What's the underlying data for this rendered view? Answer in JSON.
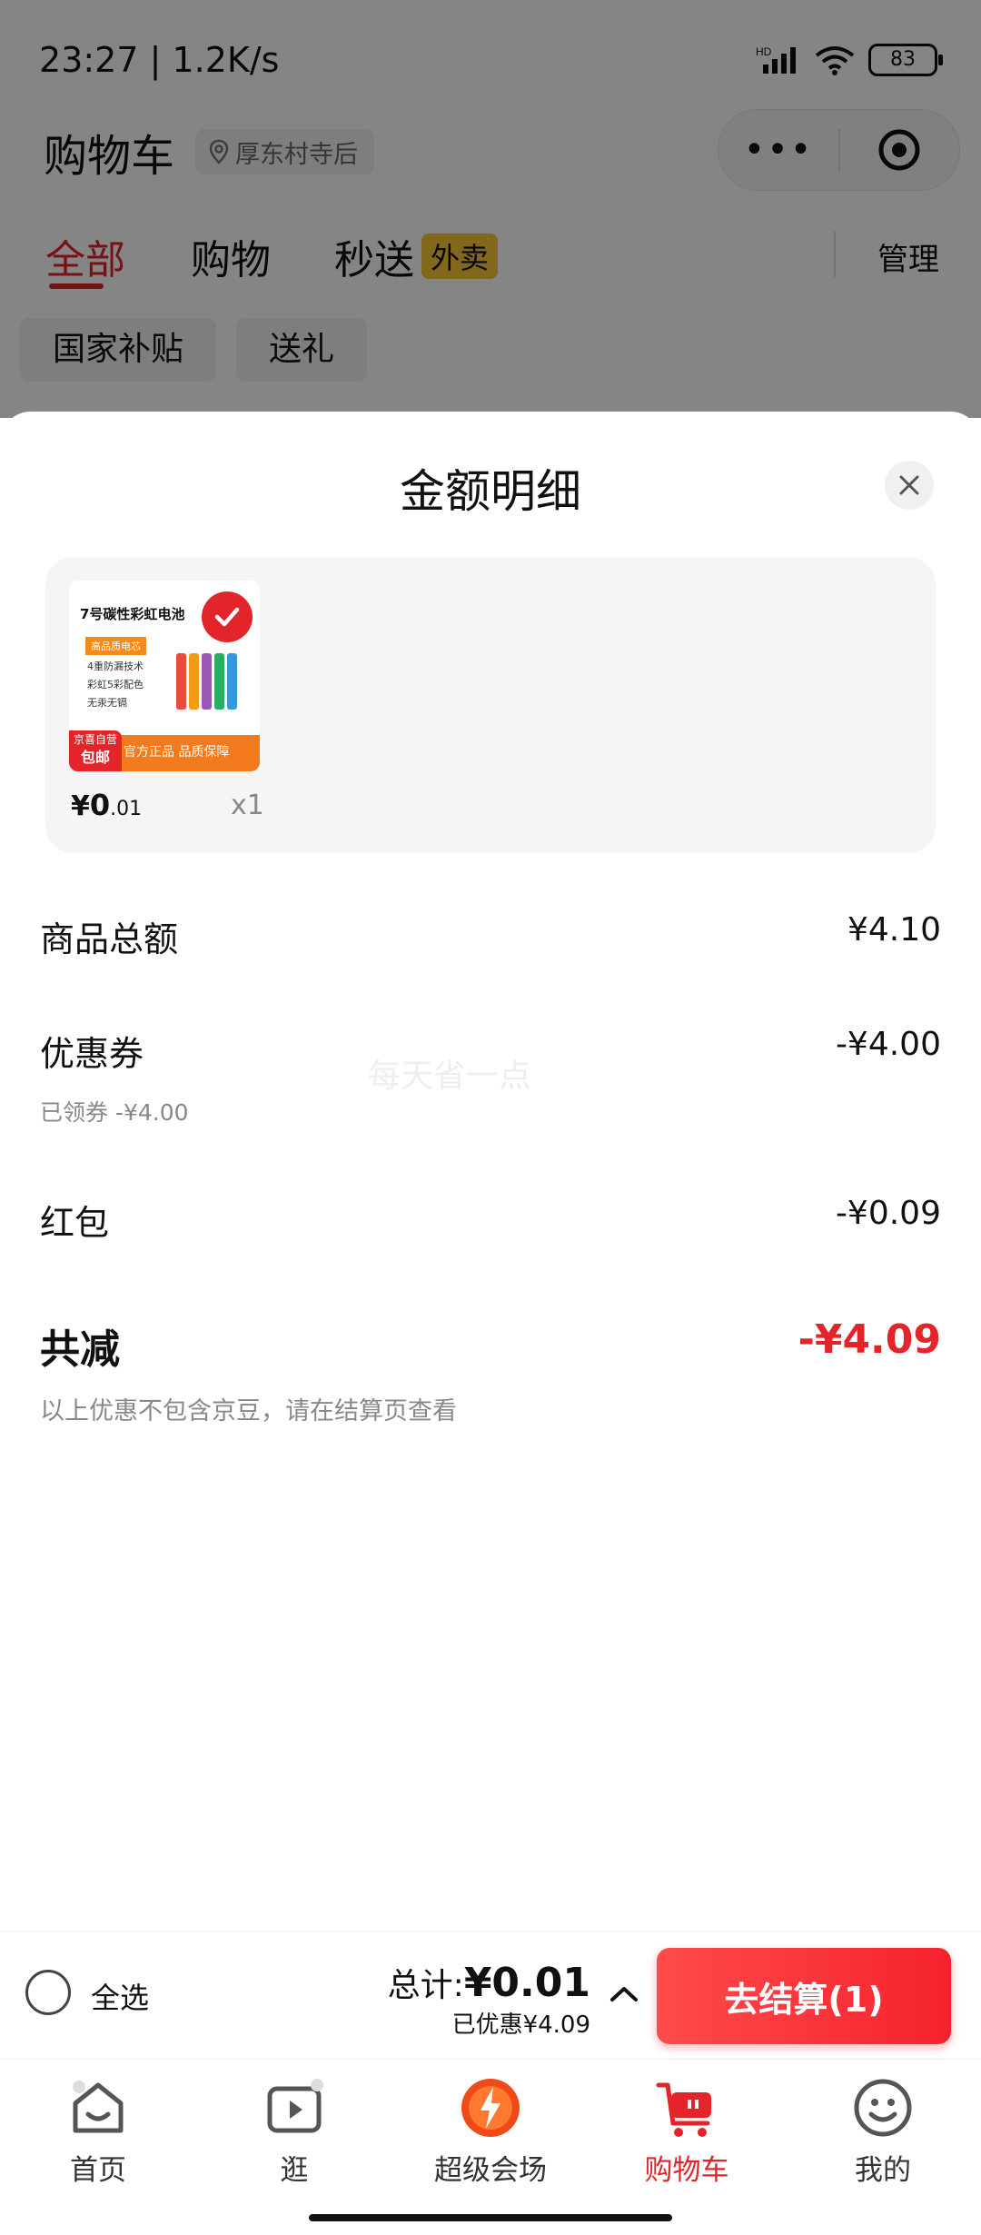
{
  "status_bar": {
    "time": "23:27 | 1.2K/s",
    "battery": "83",
    "icons": [
      "hd-signal-icon",
      "wifi-icon",
      "battery-icon"
    ]
  },
  "header": {
    "title": "购物车",
    "location": "厚东村寺后",
    "capsule_icons": [
      "more-dots-icon",
      "mini-program-target-icon"
    ]
  },
  "tabs": [
    {
      "label": "全部",
      "active": true
    },
    {
      "label": "购物"
    },
    {
      "label": "秒送",
      "badge": "外卖"
    }
  ],
  "manage_label": "管理",
  "filter_chips": [
    "国家补贴",
    "送礼"
  ],
  "sheet": {
    "title": "金额明细",
    "product": {
      "title": "7号碳性彩虹电池",
      "tag": "高品质电芯",
      "features": [
        "4重防漏技术",
        "彩虹5彩配色",
        "无汞无镉"
      ],
      "badge_line1": "京喜自营",
      "badge_line2": "包邮",
      "footer_text": "官方正品 品质保障",
      "price_currency": "¥",
      "price_int": "0",
      "price_dec": ".01",
      "quantity": "x1"
    },
    "rows": {
      "goods_total": {
        "label": "商品总额",
        "value": "¥4.10"
      },
      "coupon": {
        "label": "优惠券",
        "value": "-¥4.00",
        "note": "已领券 -¥4.00"
      },
      "red_packet": {
        "label": "红包",
        "value": "-¥0.09"
      },
      "total_discount": {
        "label": "共减",
        "value": "-¥4.09",
        "note": "以上优惠不包含京豆，请在结算页查看"
      }
    },
    "watermark": "每天省一点"
  },
  "checkout": {
    "select_all": "全选",
    "total_prefix": "总计:",
    "total_amount": "¥0.01",
    "saved": "已优惠¥4.09",
    "button": "去结算(1)"
  },
  "bottom_nav": [
    {
      "label": "首页",
      "icon": "home-icon"
    },
    {
      "label": "逛",
      "icon": "play-icon"
    },
    {
      "label": "超级会场",
      "icon": "super-venue-icon"
    },
    {
      "label": "购物车",
      "icon": "cart-icon",
      "active": true
    },
    {
      "label": "我的",
      "icon": "profile-smile-icon"
    }
  ],
  "colors": {
    "accent": "#e3242b",
    "checkout_gradient_start": "#ff4b4b",
    "waimai_badge": "#f7c836"
  }
}
